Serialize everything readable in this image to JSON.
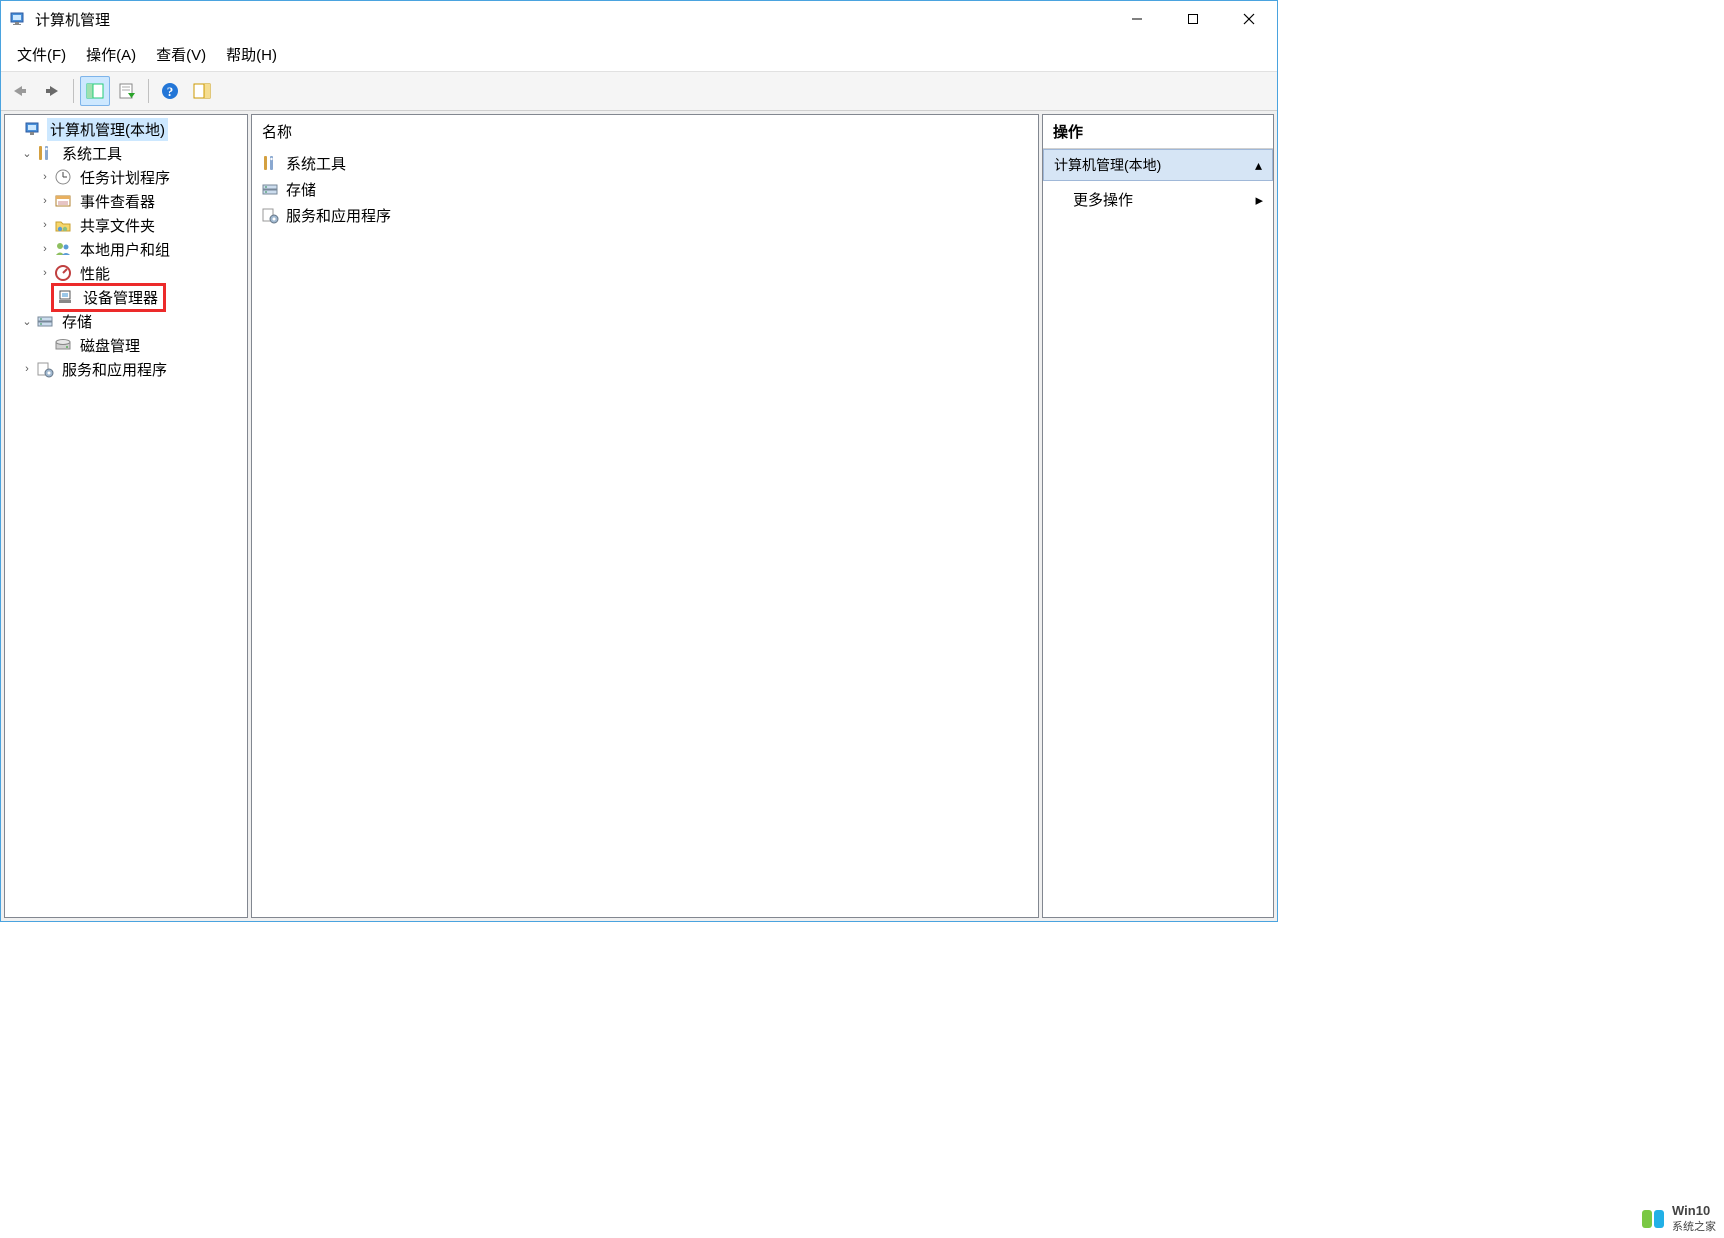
{
  "window": {
    "title": "计算机管理"
  },
  "menu": {
    "file": "文件(F)",
    "action": "操作(A)",
    "view": "查看(V)",
    "help": "帮助(H)"
  },
  "tree": {
    "root": "计算机管理(本地)",
    "system_tools": "系统工具",
    "task_scheduler": "任务计划程序",
    "event_viewer": "事件查看器",
    "shared_folders": "共享文件夹",
    "local_users": "本地用户和组",
    "performance": "性能",
    "device_manager": "设备管理器",
    "storage": "存储",
    "disk_management": "磁盘管理",
    "services_apps": "服务和应用程序"
  },
  "list": {
    "header_name": "名称",
    "items": {
      "system_tools": "系统工具",
      "storage": "存储",
      "services_apps": "服务和应用程序"
    }
  },
  "actions": {
    "header": "操作",
    "section_title": "计算机管理(本地)",
    "more_actions": "更多操作"
  },
  "watermark": {
    "line1": "Win10",
    "line2": "系统之家"
  }
}
